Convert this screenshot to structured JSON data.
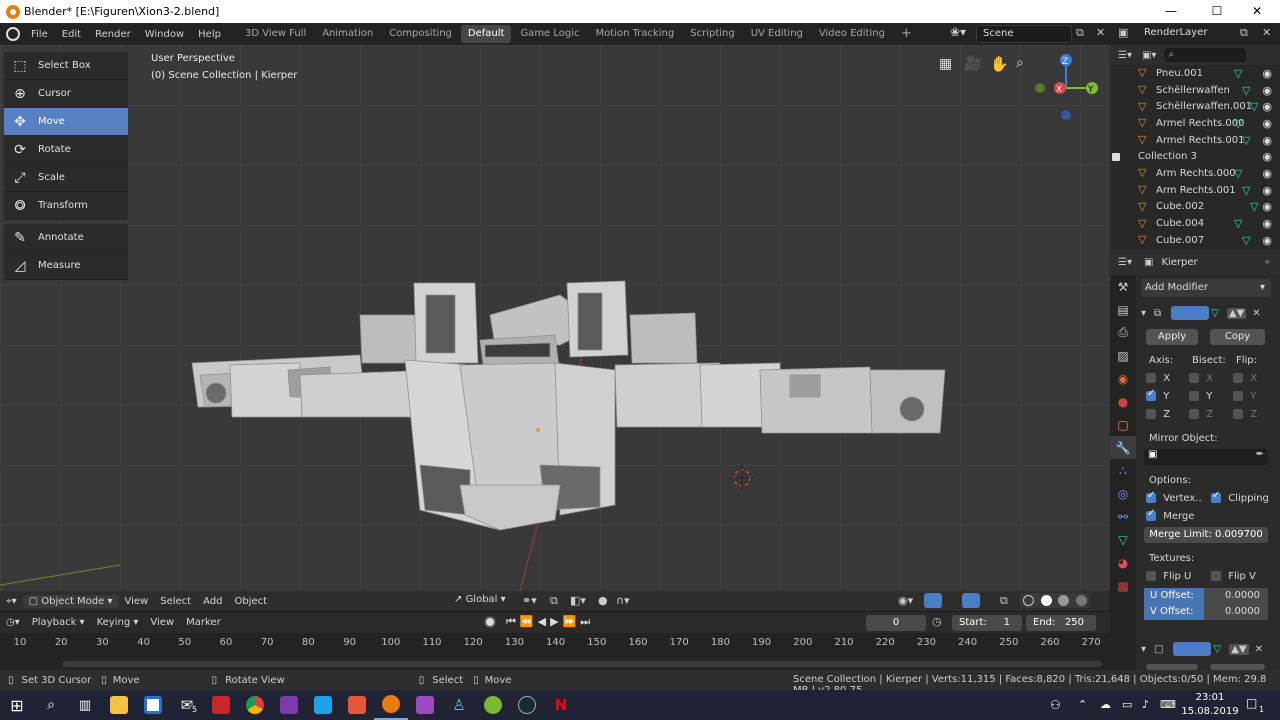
{
  "window": {
    "title": "Blender* [E:\\Figuren\\Xion3-2.blend]",
    "min_icon": "minimize-icon",
    "max_icon": "maximize-icon",
    "close_icon": "close-icon"
  },
  "menu": [
    "File",
    "Edit",
    "Render",
    "Window",
    "Help"
  ],
  "workspaces": [
    "3D View Full",
    "Animation",
    "Compositing",
    "Default",
    "Game Logic",
    "Motion Tracking",
    "Scripting",
    "UV Editing",
    "Video Editing"
  ],
  "active_workspace": "Default",
  "scene": {
    "name": "Scene",
    "render_layer": "RenderLayer"
  },
  "tools": [
    {
      "label": "Select Box",
      "icon": "select-box-icon"
    },
    {
      "label": "Cursor",
      "icon": "cursor-icon"
    },
    {
      "label": "Move",
      "icon": "move-icon"
    },
    {
      "label": "Rotate",
      "icon": "rotate-icon"
    },
    {
      "label": "Scale",
      "icon": "scale-icon"
    },
    {
      "label": "Transform",
      "icon": "transform-icon"
    },
    {
      "label": "Annotate",
      "icon": "annotate-icon"
    },
    {
      "label": "Measure",
      "icon": "measure-icon"
    }
  ],
  "viewport": {
    "perspective": "User Perspective",
    "collection": "(0) Scene Collection | Kierper"
  },
  "gizmo": {
    "z": "Z",
    "y": "Y",
    "x": "X"
  },
  "viewport_header": {
    "mode": "Object Mode",
    "view": "View",
    "select": "Select",
    "add": "Add",
    "object": "Object",
    "orientation": "Global"
  },
  "timeline": {
    "playback": "Playback",
    "keying": "Keying",
    "view": "View",
    "marker": "Marker",
    "current_frame": "0",
    "start_label": "Start:",
    "start": "1",
    "end_label": "End:",
    "end": "250"
  },
  "ruler_ticks": [
    "10",
    "20",
    "30",
    "40",
    "50",
    "60",
    "70",
    "80",
    "90",
    "100",
    "110",
    "120",
    "130",
    "140",
    "150",
    "160",
    "170",
    "180",
    "190",
    "200",
    "210",
    "220",
    "230",
    "240",
    "250",
    "260",
    "270"
  ],
  "status": {
    "left1": "Set 3D Cursor",
    "left2": "Move",
    "left3": "Rotate View",
    "left4": "Select",
    "left5": "Move",
    "right": "Scene Collection | Kierper | Verts:11,315 | Faces:8,820 | Tris:21,648 | Objects:0/50 | Mem: 29.8 MB | v2.80.75"
  },
  "outliner": [
    {
      "label": "Pneu.001",
      "type": "mesh"
    },
    {
      "label": "Schëllerwaffen",
      "type": "mesh"
    },
    {
      "label": "Schëllerwaffen.001",
      "type": "mesh"
    },
    {
      "label": "Armel Rechts.000",
      "type": "mesh"
    },
    {
      "label": "Armel Rechts.001",
      "type": "mesh"
    },
    {
      "label": "Collection 3",
      "type": "collection"
    },
    {
      "label": "Arm Rechts.000",
      "type": "mesh"
    },
    {
      "label": "Arm Rechts.001",
      "type": "mesh"
    },
    {
      "label": "Cube.002",
      "type": "mesh"
    },
    {
      "label": "Cube.004",
      "type": "mesh"
    },
    {
      "label": "Cube.007",
      "type": "mesh"
    }
  ],
  "properties": {
    "object": "Kierper",
    "add_modifier": "Add Modifier",
    "apply": "Apply",
    "copy": "Copy",
    "axis": "Axis:",
    "bisect": "Bisect:",
    "flip": "Flip:",
    "x": "X",
    "y": "Y",
    "z": "Z",
    "mirror_object": "Mirror Object:",
    "options": "Options:",
    "vertex": "Vertex..",
    "clipping": "Clipping",
    "merge": "Merge",
    "merge_limit_label": "Merge Limit:",
    "merge_limit": "0.009700",
    "textures": "Textures:",
    "flip_u": "Flip U",
    "flip_v": "Flip V",
    "u_offset_label": "U Offset:",
    "u_offset": "0.0000",
    "v_offset_label": "V Offset:",
    "v_offset": "0.0000",
    "apply2": "Apply",
    "copy2": "Copy"
  },
  "taskbar": {
    "time": "23:01",
    "date": "15.08.2019",
    "mail_badge": "5",
    "notify_badge": "1",
    "apps": [
      "start-icon",
      "search-icon",
      "taskview-icon",
      "explorer-icon",
      "store-icon",
      "mail-icon",
      "gift-icon",
      "chrome-icon",
      "affinity-photo-icon",
      "affinity-designer-icon",
      "affinity-publisher-icon",
      "blender-icon",
      "game-icon",
      "figure-icon",
      "lime-icon",
      "steam-icon",
      "netflix-icon"
    ]
  }
}
